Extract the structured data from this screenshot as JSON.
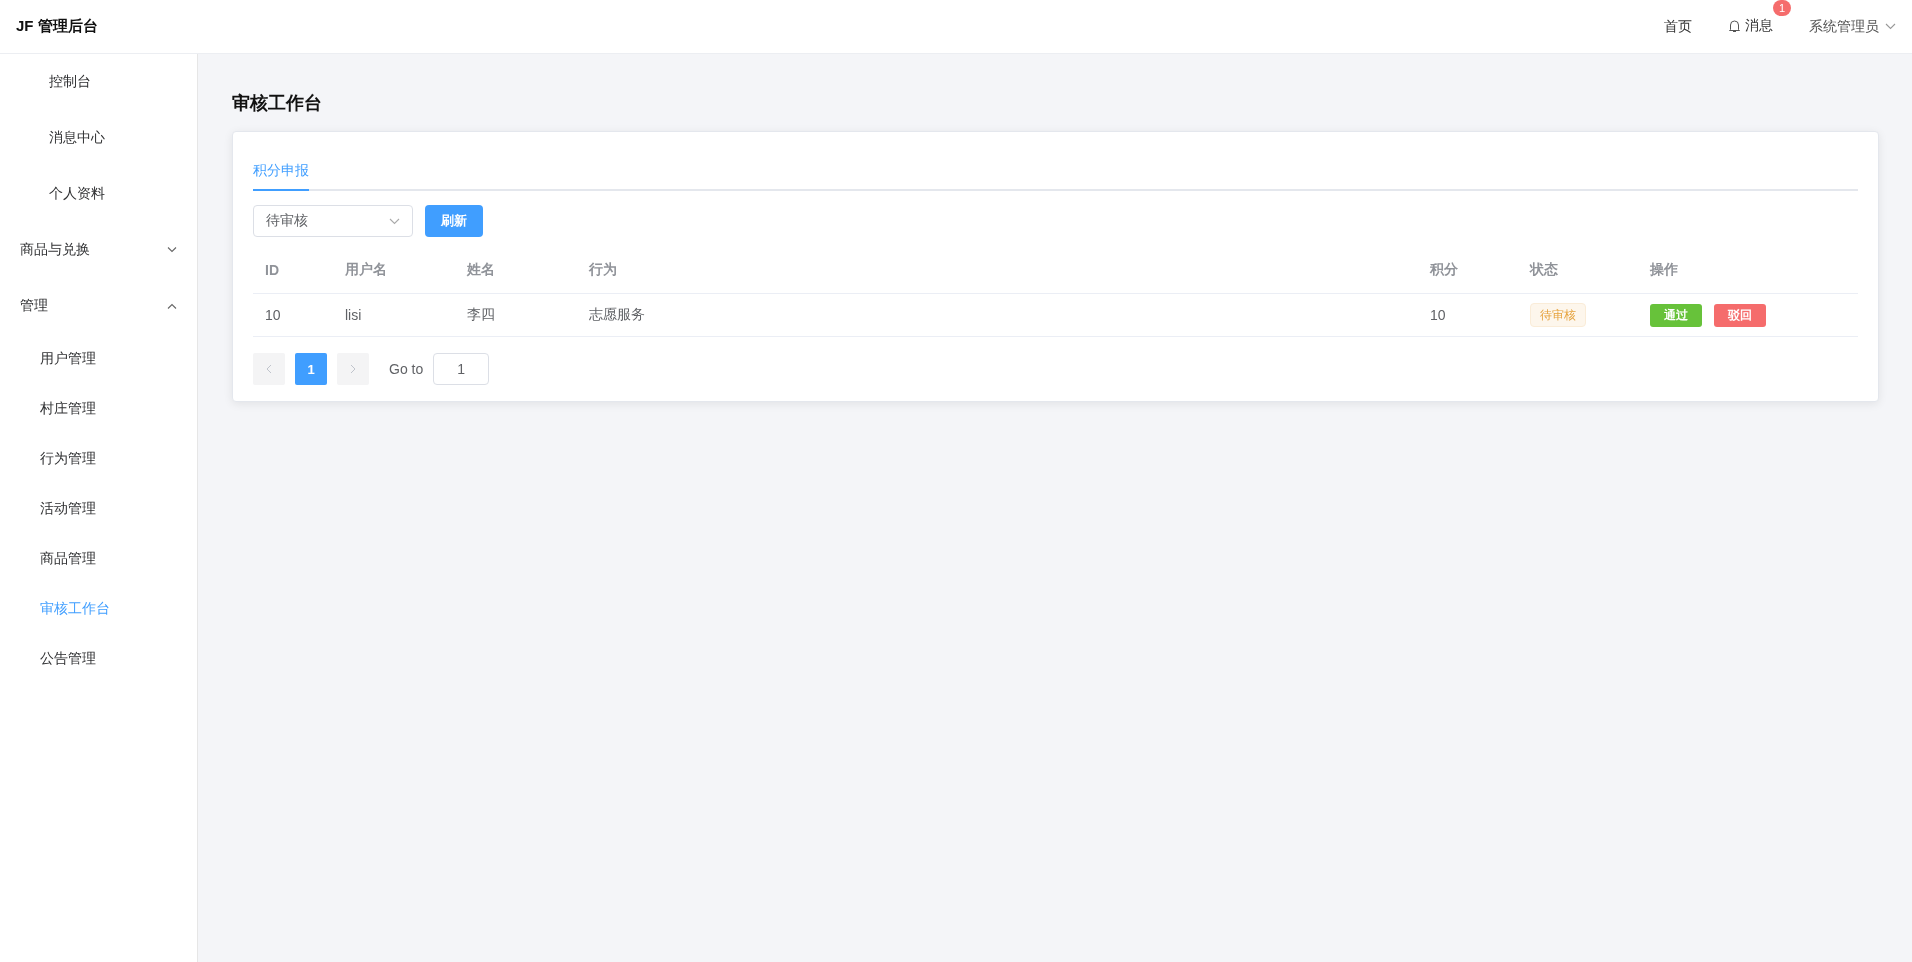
{
  "header": {
    "title": "JF 管理后台",
    "home": "首页",
    "messages": "消息",
    "message_badge": "1",
    "user": "系统管理员"
  },
  "sidebar": {
    "items": [
      {
        "label": "控制台",
        "kind": "item",
        "selected": false
      },
      {
        "label": "消息中心",
        "kind": "item",
        "selected": false
      },
      {
        "label": "个人资料",
        "kind": "item",
        "selected": false
      },
      {
        "label": "商品与兑换",
        "kind": "group",
        "expanded": false
      },
      {
        "label": "管理",
        "kind": "group",
        "expanded": true,
        "children": [
          {
            "label": "用户管理",
            "selected": false
          },
          {
            "label": "村庄管理",
            "selected": false
          },
          {
            "label": "行为管理",
            "selected": false
          },
          {
            "label": "活动管理",
            "selected": false
          },
          {
            "label": "商品管理",
            "selected": false
          },
          {
            "label": "审核工作台",
            "selected": true
          },
          {
            "label": "公告管理",
            "selected": false
          }
        ]
      }
    ]
  },
  "page_title": "审核工作台",
  "tabs": [
    {
      "label": "积分申报",
      "selected": true
    }
  ],
  "filter": {
    "value": "待审核"
  },
  "refresh_button": "刷新",
  "table": {
    "columns": [
      "ID",
      "用户名",
      "姓名",
      "行为",
      "积分",
      "状态",
      "操作"
    ],
    "rows": [
      {
        "cells": [
          "10",
          "lisi",
          "李四",
          "志愿服务",
          "10"
        ],
        "status": {
          "label": "待审核",
          "kind": "warning"
        },
        "actions": [
          {
            "label": "通过",
            "kind": "approve"
          },
          {
            "label": "驳回",
            "kind": "reject"
          }
        ]
      }
    ]
  },
  "pagination": {
    "pages": [
      {
        "label": "1",
        "selected": true
      }
    ],
    "goto_label": "Go to",
    "goto_value": "1"
  }
}
